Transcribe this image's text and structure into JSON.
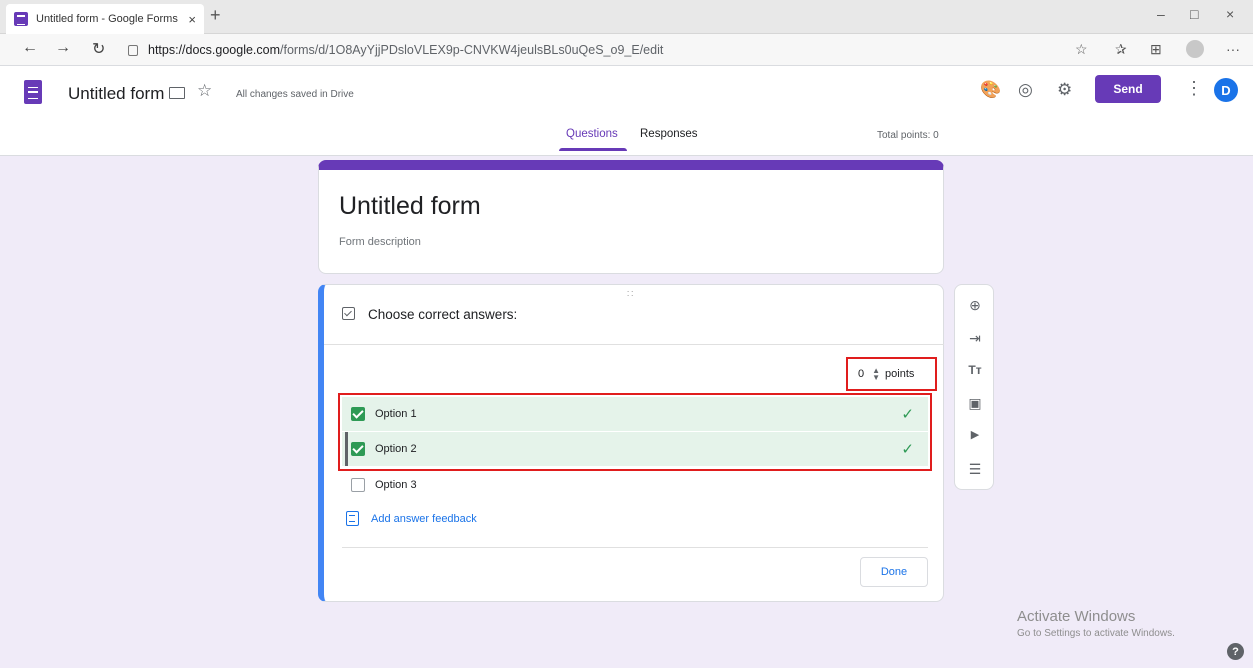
{
  "browser": {
    "tab_title": "Untitled form - Google Forms",
    "tab_close": "×",
    "new_tab": "+",
    "url_host": "https://docs.google.com",
    "url_path": "/forms/d/1O8AyYjjPDsloVLEX9p-CNVKW4jeulsBLs0uQeS_o9_E/edit",
    "minimize": "–",
    "maximize": "□",
    "close": "×",
    "back": "←",
    "forward": "→",
    "refresh": "↻",
    "favorite": "☆",
    "favorites_bar": "✰",
    "collections": "⊞",
    "more": "···"
  },
  "header": {
    "title": "Untitled form",
    "saved_status": "All changes saved in Drive",
    "send_label": "Send",
    "avatar_letter": "D",
    "kebab": "⋮",
    "star": "☆",
    "palette": "🎨",
    "preview": "◎",
    "settings": "⚙"
  },
  "tabs": {
    "questions": "Questions",
    "responses": "Responses",
    "total_points": "Total points: 0"
  },
  "form": {
    "title": "Untitled form",
    "description": "Form description"
  },
  "question": {
    "drag_handle": "∷",
    "text": "Choose correct answers:",
    "points_value": "0",
    "points_label": "points",
    "options": [
      {
        "label": "Option 1",
        "correct": true,
        "tick": "✓"
      },
      {
        "label": "Option 2",
        "correct": true,
        "tick": "✓"
      },
      {
        "label": "Option 3",
        "correct": false,
        "tick": ""
      }
    ],
    "feedback_label": "Add answer feedback",
    "done_label": "Done"
  },
  "toolbar": {
    "add_question": "⊕",
    "import_questions": "⇥",
    "add_title": "Tт",
    "add_image": "▣",
    "add_video": "▶",
    "add_section": "☰"
  },
  "watermark": {
    "line1": "Activate Windows",
    "line2": "Go to Settings to activate Windows."
  },
  "help": "?"
}
